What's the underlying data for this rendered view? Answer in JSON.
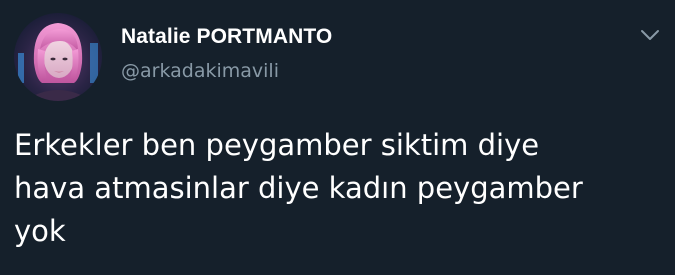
{
  "user": {
    "display_name": "Natalie PORTMANTO",
    "handle": "@arkadakimavili"
  },
  "tweet": {
    "lines": [
      "Erkekler ben peygamber siktim diye",
      "hava atmasinlar diye kadın peygamber",
      "yok"
    ]
  },
  "icons": {
    "menu": "chevron-down-icon",
    "avatar": "profile-photo"
  },
  "colors": {
    "background": "#15202b",
    "text_primary": "#ffffff",
    "text_secondary": "#8899a6"
  }
}
